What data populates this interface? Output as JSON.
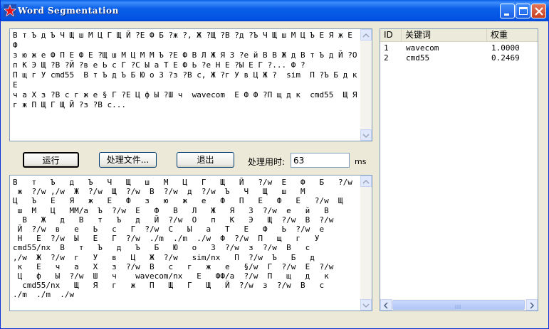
{
  "window": {
    "title": "Word Segmentation",
    "icon": "red-star-icon",
    "controls": [
      "minimize-icon",
      "maximize-icon",
      "close-icon"
    ]
  },
  "input_text": "В т Ъ д Ъ Ч Щ ш М Ц Г Щ Й ?Е Ф Б ?ж ?, Ж ?Щ ?В ?д ?Ъ Ч Щ ш М Ц Ъ Е Я ж Е Ф\nз ю ж е Ф П Е Ф Е ?Щ ш М Ц М М Ъ ?Е Ф В Л Ж Я З ?е й В В Ж д В т Ъ д Й ?О\nп К Э Щ ?В ?Й ?в е Ь с Г ?С Ы а Т Е Ф Ь ?е Н Е ?Ы Е Г ?... Ф ?\nП щ г У cmd55  В т Ъ д Ъ Б Ю о З ?з ?В с, Ж ?г У в Ц Ж ?  sim  П ?Ъ Б д к Е\nч а Х з ?В с г ж е § Г ?Е Ц ф Ы ?Ш ч  wavecom  Е Ф Ф ?П щ д к  cmd55  Щ Я\nг ж П Щ Г Щ Й ?з ?В с...",
  "buttons": {
    "run": "运行",
    "process_file": "处理文件...",
    "exit": "退出"
  },
  "timing": {
    "label": "处理用时:",
    "value": "63",
    "unit": "ms"
  },
  "output_lines": [
    "В   т   Ъ   д   Ъ   Ч   Щ   ш   М   Ц   Г   Щ   Й   ?/w  Е   Ф   Б   ?/w",
    " ж  ?/w ,/w  Ж  ?/w  Щ  ?/w  В  ?/w  д  ?/w  Ъ   Ч   Щ   ш   М",
    "Ц   Ъ   Е   Я   ж   Е   Ф   з   ю   ж   е   Ф   П   Е   Ф   Е   ?/w  Щ",
    " ш  М   Ц   ММ/a  Ъ  ?/w  Е   Ф   В   Л   Ж   Я   З  ?/w  е   й   В",
    "  В   Ж   д   В   т   Ъ   д   Й  ?/w  О   п   К   Э   Щ  ?/w  В  ?/w",
    " Й  ?/w  в   е   Ь   с   Г  ?/w  С   Ы   а   Т   Е   Ф   Ь  ?/w  е",
    " Н   Е  ?/w  Ы   Е   Г  ?/w  ./m  ./m  ./w  Ф  ?/w  П   щ   г   У",
    "cmd55/nx  В   т   Ъ   д   Ъ   Б   Ю   о   З  ?/w  з  ?/w  В   с",
    ",/w  Ж  ?/w  г   У   в   Ц   Ж  ?/w   sim/nx   П  ?/w  Ъ   Б   д",
    " к   Е   ч   а   Х   з  ?/w  В   с   г   ж   е   §/w  Г  ?/w  Е  ?/w",
    " Ц   ф   Ы  ?/w  Ш   ч    wavecom/nx   Е   ФФ/a  ?/w  П   щ   д   к",
    "  cmd55/nx   Щ   Я   г   ж   П   Щ   Г   Щ   Й  ?/w  з  ?/w  В   с",
    "./m  ./m  ./w"
  ],
  "keywords": {
    "columns": [
      "ID",
      "关键词",
      "权重"
    ],
    "rows": [
      {
        "id": "1",
        "word": "wavecom",
        "weight": "1.0000"
      },
      {
        "id": "2",
        "word": "cmd55",
        "weight": "0.2469"
      }
    ]
  }
}
